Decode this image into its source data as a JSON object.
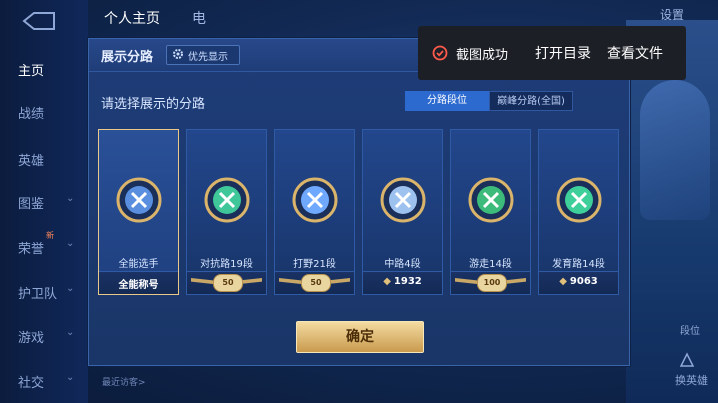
{
  "top_tabs": [
    "个人主页",
    "电"
  ],
  "settings_label": "设置",
  "sidebar": {
    "items": [
      {
        "label": "主页",
        "has_arrow": false
      },
      {
        "label": "战绩",
        "has_arrow": false
      },
      {
        "label": "英雄",
        "has_arrow": false
      },
      {
        "label": "图鉴",
        "has_arrow": true
      },
      {
        "label": "荣誉",
        "has_arrow": true
      },
      {
        "label": "护卫队",
        "has_arrow": true
      },
      {
        "label": "游戏",
        "has_arrow": true
      },
      {
        "label": "社交",
        "has_arrow": true
      }
    ],
    "badge_new": "新"
  },
  "recent_visitors": "最近访客>",
  "right_panel": {
    "rank_label": "段位",
    "swap_label": "换英雄"
  },
  "dialog": {
    "title": "展示分路",
    "priority_label": "优先显示",
    "prompt": "请选择展示的分路",
    "segments": {
      "active": "分路段位",
      "inactive": "巅峰分路(全国)"
    },
    "cards": [
      {
        "name": "全能选手",
        "footer_type": "text",
        "footer": "全能称号",
        "color": "#5a8fe0"
      },
      {
        "name": "对抗路19段",
        "footer_type": "badge",
        "footer": "50",
        "color": "#3fc79a"
      },
      {
        "name": "打野21段",
        "footer_type": "badge",
        "footer": "50",
        "color": "#6fa8ff"
      },
      {
        "name": "中路4段",
        "footer_type": "score",
        "footer": "1932",
        "color": "#9ec2ef"
      },
      {
        "name": "游走14段",
        "footer_type": "badge",
        "footer": "100",
        "color": "#3dbb7a"
      },
      {
        "name": "发育路14段",
        "footer_type": "score",
        "footer": "9063",
        "color": "#3fcf9a"
      }
    ],
    "confirm_label": "确定"
  },
  "toast": {
    "message": "截图成功",
    "open_dir": "打开目录",
    "view_file": "查看文件"
  },
  "colors": {
    "accent": "#2d6ad0",
    "gold": "#e8c98a",
    "background": "#122a55"
  }
}
